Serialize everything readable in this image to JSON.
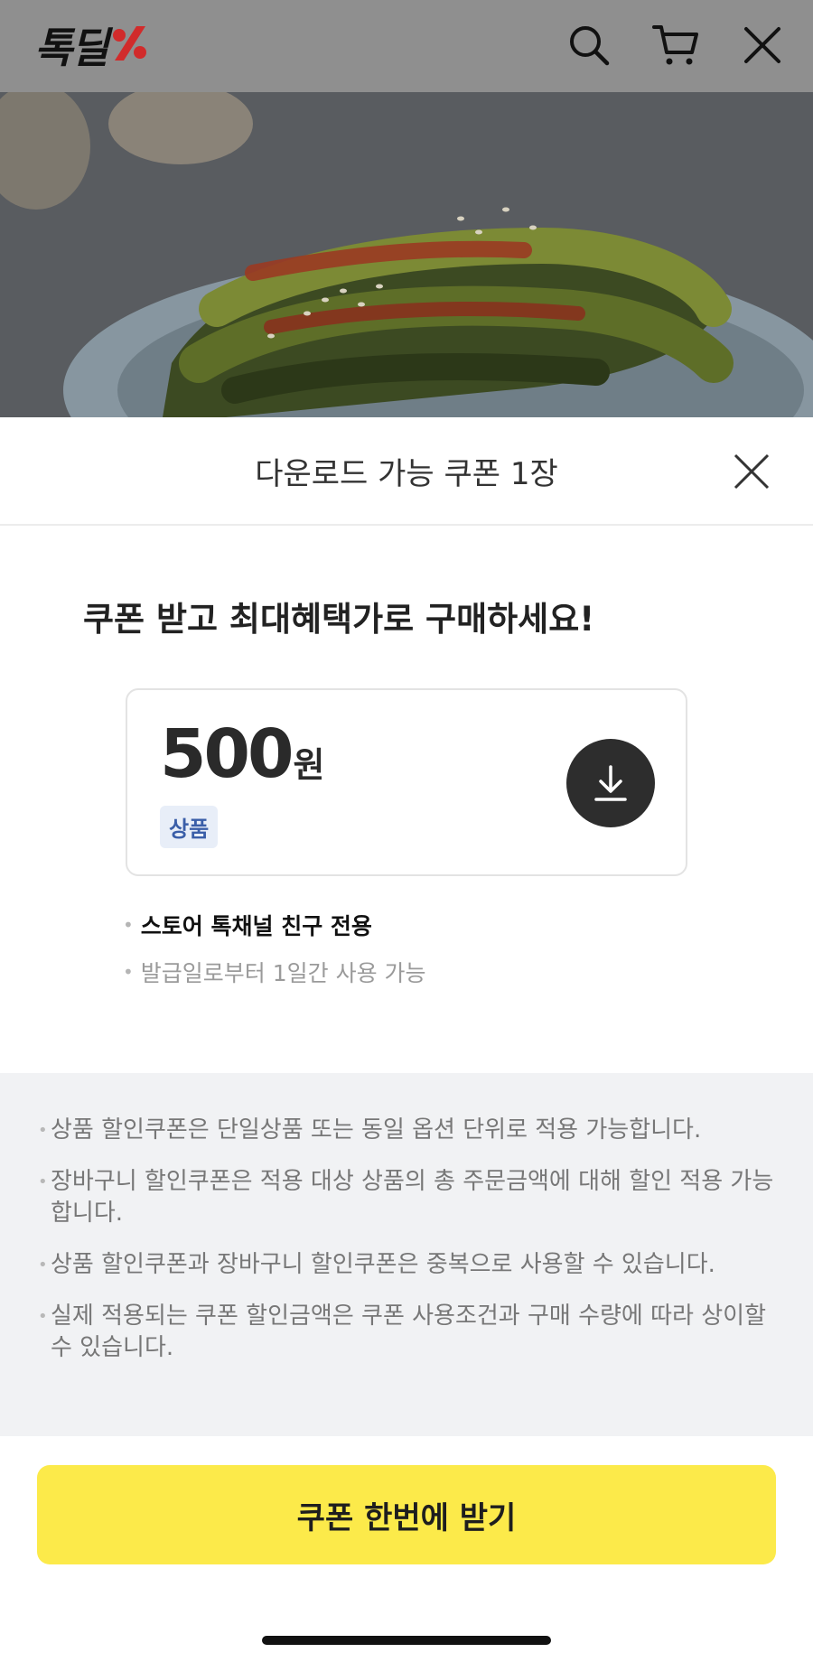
{
  "header": {
    "logo_text": "톡딜",
    "icons": [
      "search-icon",
      "cart-icon",
      "close-icon"
    ],
    "background": "#8f8f8f"
  },
  "hero": {
    "image": "kimchi-photo"
  },
  "sheet": {
    "title": "다운로드 가능 쿠폰 1장",
    "headline": "쿠폰 받고 최대혜택가로 구매하세요!",
    "coupon": {
      "amount": "500",
      "unit": "원",
      "tag": "상품"
    },
    "conditions": [
      "스토어 톡채널 친구 전용",
      "발급일로부터 1일간 사용 가능"
    ],
    "notices": [
      "상품 할인쿠폰은 단일상품 또는 동일 옵션 단위로 적용 가능합니다.",
      "장바구니 할인쿠폰은 적용 대상 상품의 총 주문금액에 대해 할인 적용 가능합니다.",
      "상품 할인쿠폰과 장바구니 할인쿠폰은 중복으로 사용할 수 있습니다.",
      "실제 적용되는 쿠폰 할인금액은 쿠폰 사용조건과 구매 수량에 따라 상이할 수 있습니다."
    ],
    "cta_label": "쿠폰 한번에 받기"
  },
  "colors": {
    "cta": "#fcea4a",
    "logo_accent": "#e03030",
    "tag_text": "#3a5ea8",
    "download_button": "#2d2d2d"
  }
}
